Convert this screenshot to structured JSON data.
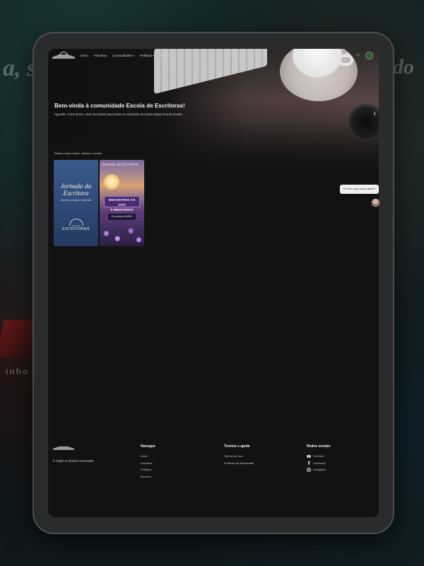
{
  "nav": {
    "links": [
      "Início",
      "Favoritos",
      "Comunidades",
      "Publique",
      "Escreva"
    ],
    "has_chevron": [
      false,
      false,
      true,
      true,
      true
    ]
  },
  "hero": {
    "title": "Bem-vinda à comunidade Escola de Escritoras!",
    "description": "Aguarde +3 Em Breve, você encontrará aqui todos os conteúdos da nossa antiga Área de Escrita."
  },
  "section": {
    "label": "Nossos cursos, clubes, oficinas e eventos"
  },
  "cards": [
    {
      "title_line1": "Jornada da",
      "title_line2": "Escritora",
      "subtitle": "Escreva, publique e seja lida",
      "brand_top": "Escola de",
      "brand_bottom": "ESCRITORAS"
    },
    {
      "title": "Jornada da Escritora",
      "box_line1": "ENCONTROS AO VIVO",
      "box_line2": "E MENTORIAS",
      "pill": "Cronônica 2025/2"
    }
  ],
  "footer": {
    "copyright": "© Todos os direitos reservados",
    "columns": [
      {
        "title": "Navegue",
        "links": [
          "Início",
          "Favoritos",
          "Publique",
          "Escreva"
        ]
      },
      {
        "title": "Termos e ajuda",
        "links": [
          "Termos de uso",
          "Políticas de privacidade"
        ]
      },
      {
        "title": "Redes sociais",
        "links": [
          "YouTube",
          "Facebook",
          "Instagram"
        ],
        "icons": [
          "youtube-icon",
          "facebook-icon",
          "instagram-icon"
        ]
      }
    ]
  },
  "chat": {
    "prompt": "Oi! Com o que posso ajudar?"
  },
  "backdrop": {
    "text_left": "a, s",
    "text_right": "do",
    "text_bottom": "inho"
  },
  "colors": {
    "background": "#121212",
    "accent_purple": "#4a2a6c",
    "avatar_green": "#2f5a3a"
  }
}
